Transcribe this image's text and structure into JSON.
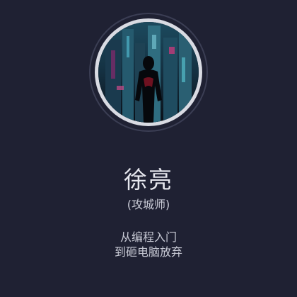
{
  "profile": {
    "name": "徐亮",
    "role": "(攻城师)",
    "motto_line1": "从编程入门",
    "motto_line2": "到砸电脑放弃",
    "avatar_icon": "spiderman-city-avatar"
  },
  "colors": {
    "background": "#1f2133",
    "avatar_border": "#d9dbe3",
    "outer_ring": "#3b3e54",
    "text_primary": "#e6e7ee",
    "text_secondary": "#c9cbd6"
  }
}
